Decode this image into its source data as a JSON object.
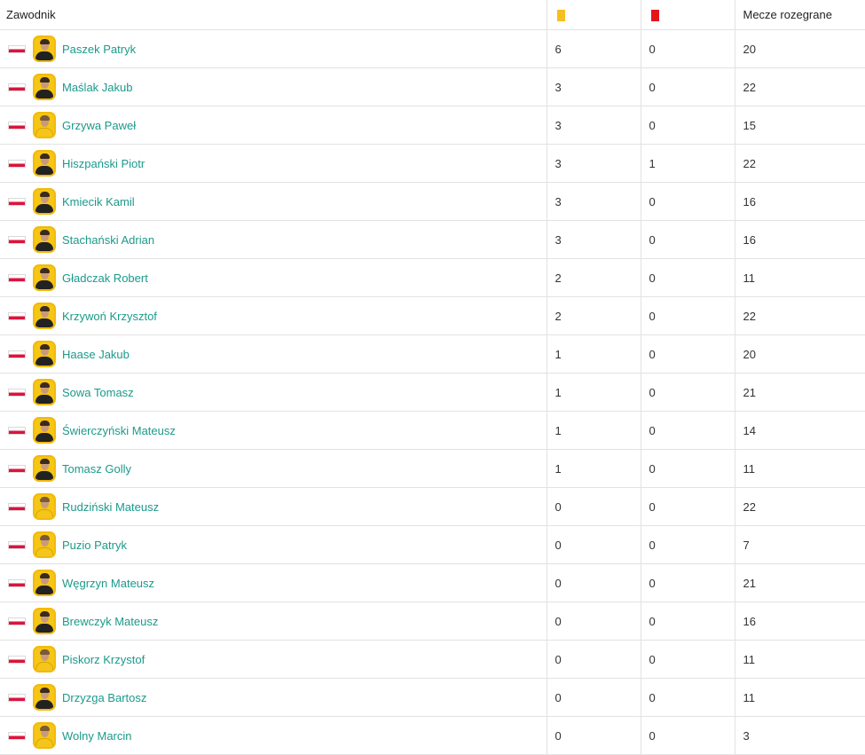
{
  "header": {
    "player_label": "Zawodnik",
    "yellow_icon": "yellow-card-icon",
    "red_icon": "red-card-icon",
    "games_label": "Mecze rozegrane"
  },
  "colors": {
    "yellow_card": "#f5bf1d",
    "red_card": "#e3161b",
    "link": "#1b9a8b",
    "avatar_bg": "#f6c614"
  },
  "players": [
    {
      "name": "Paszek Patryk",
      "yellow": "6",
      "red": "0",
      "games": "20",
      "shirt": "dark"
    },
    {
      "name": "Maślak Jakub",
      "yellow": "3",
      "red": "0",
      "games": "22",
      "shirt": "dark"
    },
    {
      "name": "Grzywa Paweł",
      "yellow": "3",
      "red": "0",
      "games": "15",
      "shirt": "light"
    },
    {
      "name": "Hiszpański Piotr",
      "yellow": "3",
      "red": "1",
      "games": "22",
      "shirt": "dark"
    },
    {
      "name": "Kmiecik Kamil",
      "yellow": "3",
      "red": "0",
      "games": "16",
      "shirt": "dark"
    },
    {
      "name": "Stachański Adrian",
      "yellow": "3",
      "red": "0",
      "games": "16",
      "shirt": "dark"
    },
    {
      "name": "Gładczak Robert",
      "yellow": "2",
      "red": "0",
      "games": "11",
      "shirt": "dark"
    },
    {
      "name": "Krzywoń Krzysztof",
      "yellow": "2",
      "red": "0",
      "games": "22",
      "shirt": "dark"
    },
    {
      "name": "Haase Jakub",
      "yellow": "1",
      "red": "0",
      "games": "20",
      "shirt": "dark"
    },
    {
      "name": "Sowa Tomasz",
      "yellow": "1",
      "red": "0",
      "games": "21",
      "shirt": "dark"
    },
    {
      "name": "Świerczyński Mateusz",
      "yellow": "1",
      "red": "0",
      "games": "14",
      "shirt": "dark"
    },
    {
      "name": "Tomasz Golly",
      "yellow": "1",
      "red": "0",
      "games": "11",
      "shirt": "dark"
    },
    {
      "name": "Rudziński Mateusz",
      "yellow": "0",
      "red": "0",
      "games": "22",
      "shirt": "light"
    },
    {
      "name": "Puzio Patryk",
      "yellow": "0",
      "red": "0",
      "games": "7",
      "shirt": "light"
    },
    {
      "name": "Węgrzyn Mateusz",
      "yellow": "0",
      "red": "0",
      "games": "21",
      "shirt": "dark"
    },
    {
      "name": "Brewczyk Mateusz",
      "yellow": "0",
      "red": "0",
      "games": "16",
      "shirt": "dark"
    },
    {
      "name": "Piskorz Krzystof",
      "yellow": "0",
      "red": "0",
      "games": "11",
      "shirt": "light"
    },
    {
      "name": "Drzyzga Bartosz",
      "yellow": "0",
      "red": "0",
      "games": "11",
      "shirt": "dark"
    },
    {
      "name": "Wolny Marcin",
      "yellow": "0",
      "red": "0",
      "games": "3",
      "shirt": "light"
    }
  ]
}
